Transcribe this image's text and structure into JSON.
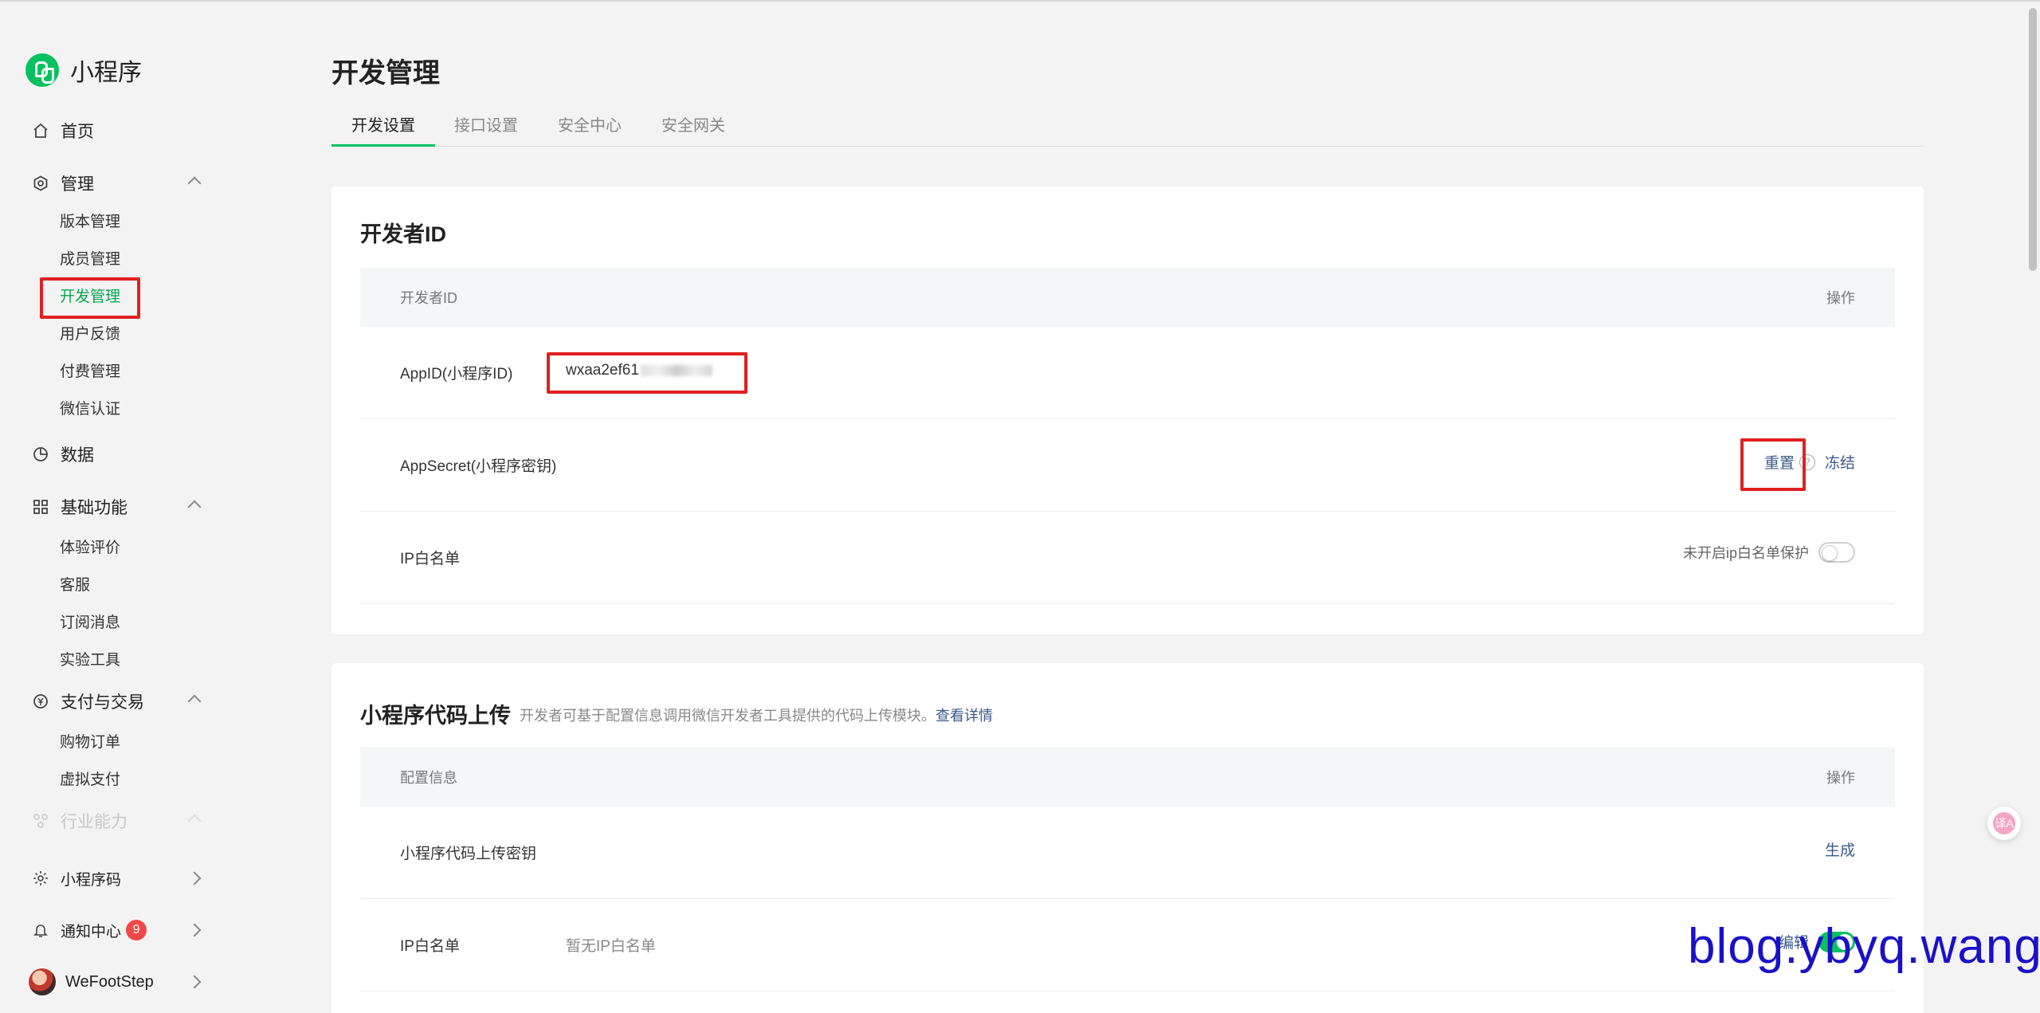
{
  "brand": {
    "name": "小程序",
    "logo_icon": "miniprogram-logo-icon",
    "color": "#07c160"
  },
  "sidebar": {
    "home": {
      "label": "首页",
      "icon": "home-icon"
    },
    "manage": {
      "label": "管理",
      "icon": "settings-icon",
      "items": [
        "版本管理",
        "成员管理",
        "开发管理",
        "用户反馈",
        "付费管理",
        "微信认证"
      ]
    },
    "data": {
      "label": "数据",
      "icon": "pie-chart-icon"
    },
    "basic": {
      "label": "基础功能",
      "icon": "grid-icon",
      "items": [
        "体验评价",
        "客服",
        "订阅消息",
        "实验工具"
      ]
    },
    "pay": {
      "label": "支付与交易",
      "icon": "yen-icon",
      "items": [
        "购物订单",
        "虚拟支付"
      ]
    },
    "industry": {
      "label": "行业能力",
      "icon": "industry-icon"
    },
    "qrcode": {
      "label": "小程序码",
      "icon": "sun-icon"
    },
    "notify": {
      "label": "通知中心",
      "icon": "bell-icon",
      "badge": "9"
    },
    "account": {
      "label": "WeFootStep"
    }
  },
  "page": {
    "title": "开发管理",
    "tabs": [
      "开发设置",
      "接口设置",
      "安全中心",
      "安全网关"
    ]
  },
  "dev_id_card": {
    "title": "开发者ID",
    "head_col1": "开发者ID",
    "head_col2": "操作",
    "appid": {
      "name": "AppID(小程序ID)",
      "value": "wxaa2ef61"
    },
    "appsecret": {
      "name": "AppSecret(小程序密钥)",
      "reset": "重置",
      "help": "?",
      "freeze": "冻结"
    },
    "ip": {
      "name": "IP白名单",
      "status": "未开启ip白名单保护"
    }
  },
  "upload_card": {
    "title": "小程序代码上传",
    "desc": "开发者可基于配置信息调用微信开发者工具提供的代码上传模块。",
    "desc_link": "查看详情",
    "head_col1": "配置信息",
    "head_col2": "操作",
    "key": {
      "name": "小程序代码上传密钥",
      "action": "生成"
    },
    "ip": {
      "name": "IP白名单",
      "value": "暂无IP白名单",
      "action": "编辑"
    }
  },
  "float_button": {
    "label": "译A"
  },
  "watermark": "blog.ybyq.wang"
}
